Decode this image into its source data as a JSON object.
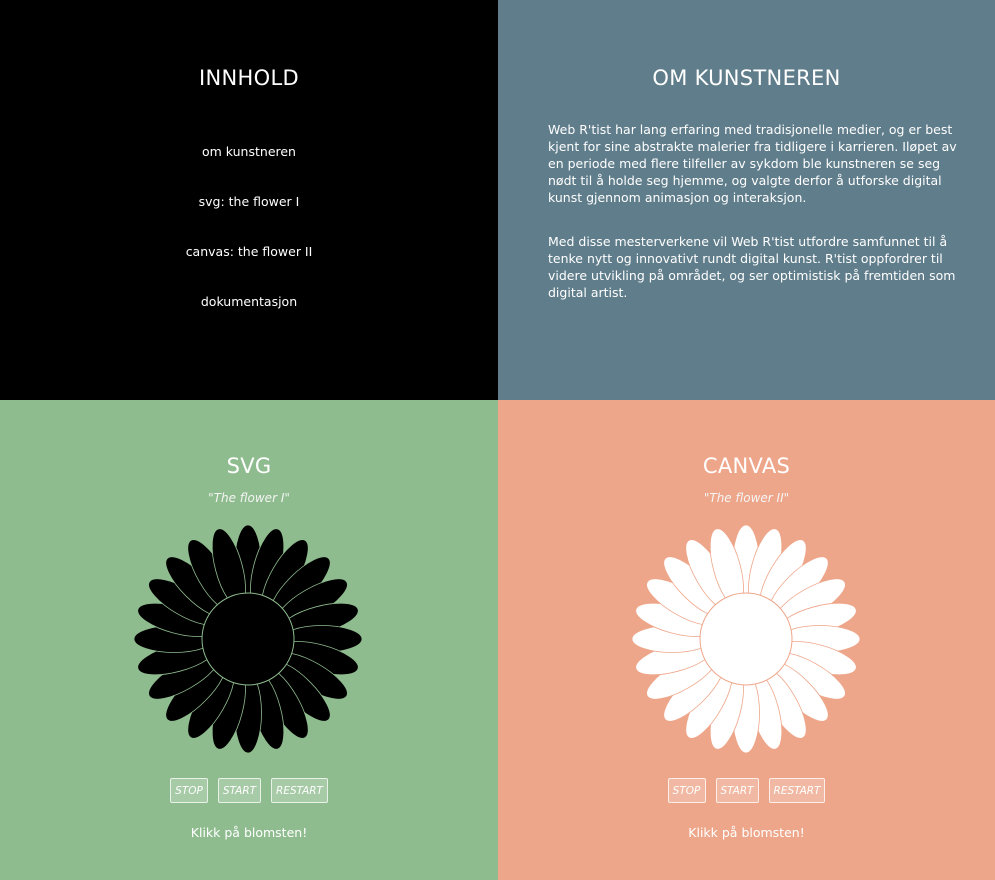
{
  "nav": {
    "title": "INNHOLD",
    "items": [
      {
        "label": "om kunstneren"
      },
      {
        "label": "svg: the flower I"
      },
      {
        "label": "canvas: the flower II"
      },
      {
        "label": "dokumentasjon"
      }
    ]
  },
  "about": {
    "title": "OM KUNSTNEREN",
    "paragraphs": [
      "Web R'tist har lang erfaring med tradisjonelle medier, og er best kjent for sine abstrakte malerier fra tidligere i karrieren. Iløpet av en periode med flere tilfeller av sykdom ble kunstneren se seg nødt til å holde seg hjemme, og valgte derfor å utforske digital kunst gjennom animasjon og interaksjon.",
      "Med disse mesterverkene vil Web R'tist utfordre samfunnet til å tenke nytt og innovativt rundt digital kunst. R'tist oppfordrer til videre utvikling på området, og ser optimistisk på fremtiden som digital artist."
    ]
  },
  "svg_panel": {
    "title": "SVG",
    "subtitle": "\"The flower I\"",
    "buttons": {
      "stop": "STOP",
      "start": "START",
      "restart": "RESTART"
    },
    "hint": "Klikk på blomsten!",
    "flower_fill": "#000000",
    "flower_stroke": "#8fbc8f",
    "background": "#8fbc8f"
  },
  "canvas_panel": {
    "title": "CANVAS",
    "subtitle": "\"The flower II\"",
    "buttons": {
      "stop": "STOP",
      "start": "START",
      "restart": "RESTART"
    },
    "hint": "Klikk på blomsten!",
    "flower_fill": "#ffffff",
    "flower_stroke": "#eea68a",
    "background": "#eea68a"
  }
}
